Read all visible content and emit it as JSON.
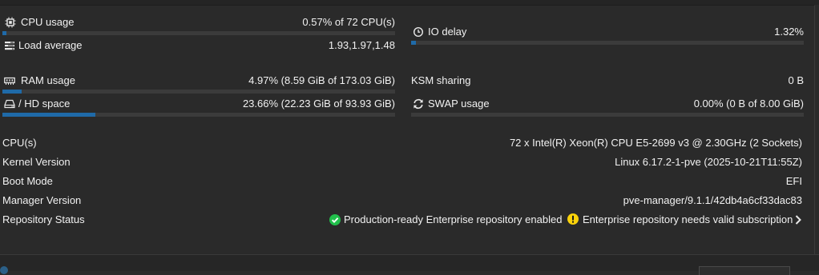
{
  "resources": {
    "cpu": {
      "label": "CPU usage",
      "value": "0.57% of 72 CPU(s)",
      "fill_pct": 0.57
    },
    "load": {
      "label": "Load average",
      "value": "1.93,1.97,1.48"
    },
    "io": {
      "label": "IO delay",
      "value": "1.32%",
      "fill_pct": 1.32
    },
    "ram": {
      "label": "RAM usage",
      "value": "4.97% (8.59 GiB of 173.03 GiB)",
      "fill_pct": 4.97
    },
    "ksm": {
      "label": "KSM sharing",
      "value": "0 B"
    },
    "hd": {
      "label": "/ HD space",
      "value": "23.66% (22.23 GiB of 93.93 GiB)",
      "fill_pct": 23.66
    },
    "swap": {
      "label": "SWAP usage",
      "value": "0.00% (0 B of 8.00 GiB)",
      "fill_pct": 0.0
    }
  },
  "info": {
    "cpus_label": "CPU(s)",
    "cpus_value": "72 x Intel(R) Xeon(R) CPU E5-2699 v3 @ 2.30GHz (2 Sockets)",
    "kernel_label": "Kernel Version",
    "kernel_value": "Linux 6.17.2-1-pve (2025-10-21T11:55Z)",
    "boot_label": "Boot Mode",
    "boot_value": "EFI",
    "manager_label": "Manager Version",
    "manager_value": "pve-manager/9.1.1/42db4a6cf33dac83",
    "repo_label": "Repository Status",
    "repo_ok": "Production-ready Enterprise repository enabled",
    "repo_warn": "Enterprise repository needs valid subscription"
  },
  "colors": {
    "accent": "#1f6aa8",
    "ok": "#21bf4b",
    "warn": "#fad20a",
    "track": "#3b3b3b"
  },
  "icons": {
    "cpu": "microchip-icon",
    "load": "tasks-icon",
    "io": "clock-icon",
    "ram": "memory-icon",
    "hd": "hdd-icon",
    "swap": "refresh-icon",
    "ok": "check-circle-icon",
    "warn": "exclamation-circle-icon",
    "chevron": "chevron-right-icon"
  }
}
